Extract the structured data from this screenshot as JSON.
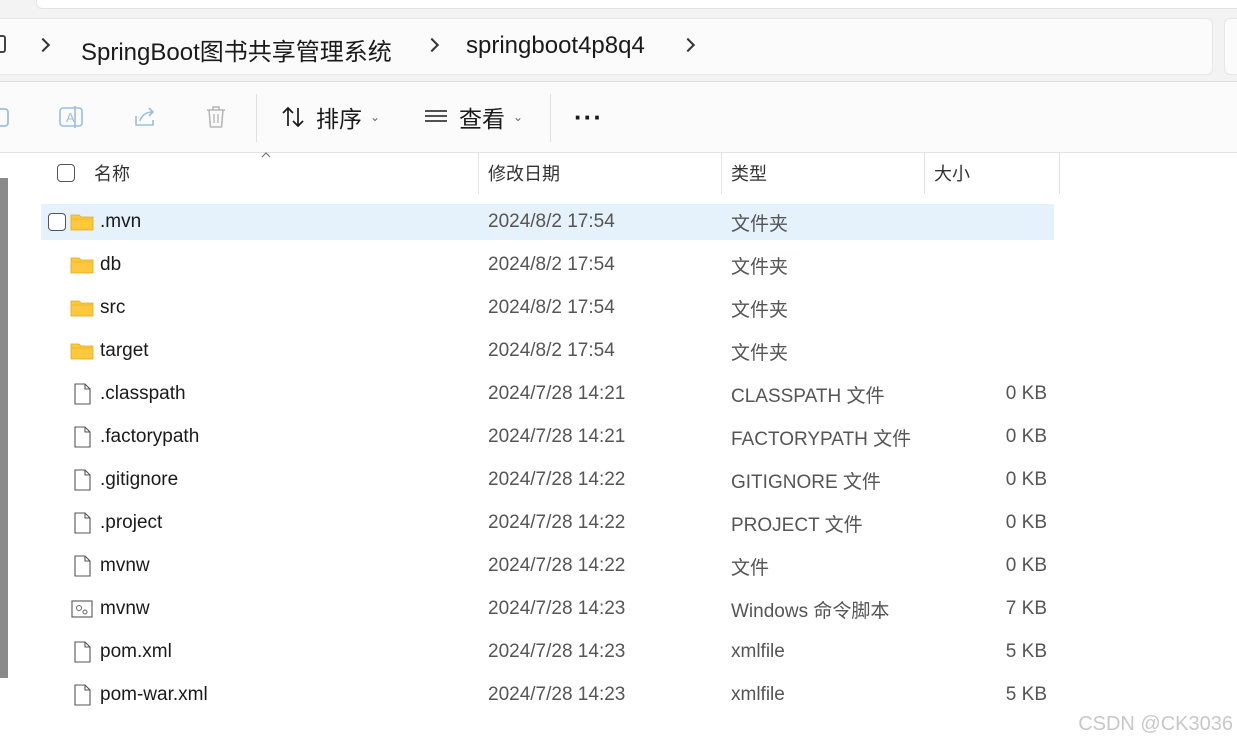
{
  "breadcrumb": {
    "items": [
      "SpringBoot图书共享管理系统",
      "springboot4p8q4"
    ]
  },
  "toolbar": {
    "sort_label": "排序",
    "view_label": "查看",
    "more_label": "···"
  },
  "columns": {
    "name": "名称",
    "date": "修改日期",
    "type": "类型",
    "size": "大小"
  },
  "files": [
    {
      "name": ".mvn",
      "date": "2024/8/2 17:54",
      "type": "文件夹",
      "size": "",
      "icon": "folder-icon",
      "selected": true
    },
    {
      "name": "db",
      "date": "2024/8/2 17:54",
      "type": "文件夹",
      "size": "",
      "icon": "folder-icon"
    },
    {
      "name": "src",
      "date": "2024/8/2 17:54",
      "type": "文件夹",
      "size": "",
      "icon": "folder-icon"
    },
    {
      "name": "target",
      "date": "2024/8/2 17:54",
      "type": "文件夹",
      "size": "",
      "icon": "folder-icon"
    },
    {
      "name": ".classpath",
      "date": "2024/7/28 14:21",
      "type": "CLASSPATH 文件",
      "size": "0 KB",
      "icon": "file-icon"
    },
    {
      "name": ".factorypath",
      "date": "2024/7/28 14:21",
      "type": "FACTORYPATH 文件",
      "size": "0 KB",
      "icon": "file-icon"
    },
    {
      "name": ".gitignore",
      "date": "2024/7/28 14:22",
      "type": "GITIGNORE 文件",
      "size": "0 KB",
      "icon": "file-icon"
    },
    {
      "name": ".project",
      "date": "2024/7/28 14:22",
      "type": "PROJECT 文件",
      "size": "0 KB",
      "icon": "file-icon"
    },
    {
      "name": "mvnw",
      "date": "2024/7/28 14:22",
      "type": "文件",
      "size": "0 KB",
      "icon": "file-icon"
    },
    {
      "name": "mvnw",
      "date": "2024/7/28 14:23",
      "type": "Windows 命令脚本",
      "size": "7 KB",
      "icon": "script-file-icon"
    },
    {
      "name": "pom.xml",
      "date": "2024/7/28 14:23",
      "type": "xmlfile",
      "size": "5 KB",
      "icon": "file-icon"
    },
    {
      "name": "pom-war.xml",
      "date": "2024/7/28 14:23",
      "type": "xmlfile",
      "size": "5 KB",
      "icon": "file-icon"
    }
  ],
  "watermark": "CSDN @CK3036",
  "colors": {
    "selection": "#e5f1fb",
    "folder": "#ffc83d"
  }
}
